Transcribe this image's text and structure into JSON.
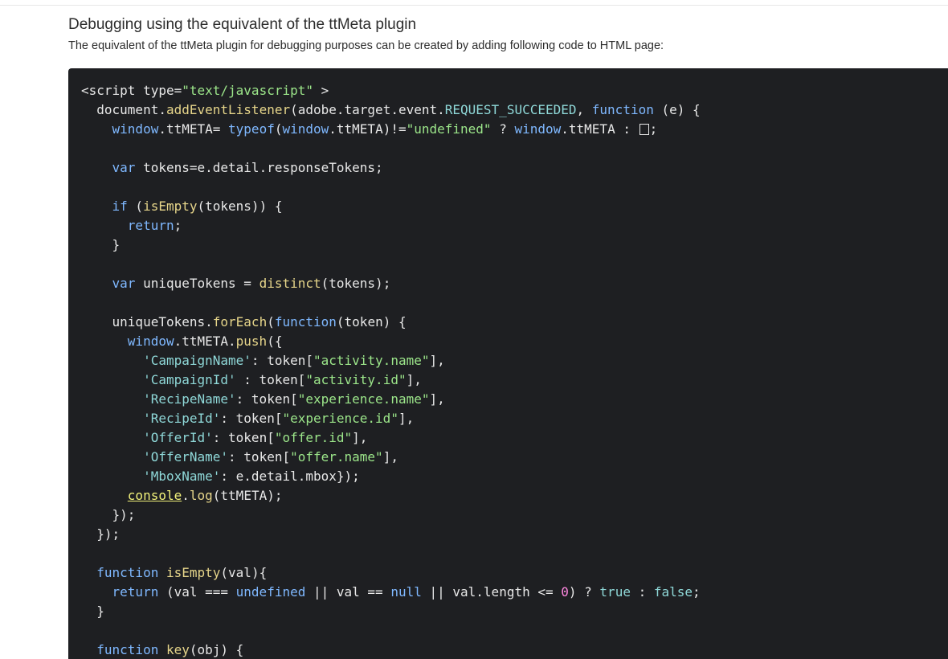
{
  "section": {
    "heading": "Debugging using the equivalent of the ttMeta plugin",
    "description": "The equivalent of the ttMeta plugin for debugging purposes can be created by adding following code to HTML page:"
  },
  "colors": {
    "code_background": "#1e1f22",
    "keyword": "#7fb8ff",
    "function": "#e6d58a",
    "string": "#9ce68a",
    "constant": "#8fd8d8",
    "number": "#ff88e0"
  },
  "code": {
    "language": "javascript",
    "lines": [
      [
        {
          "t": "<script type=",
          "c": "plain"
        },
        {
          "t": "\"text/javascript\"",
          "c": "str"
        },
        {
          "t": " >",
          "c": "plain"
        }
      ],
      [
        {
          "t": "  document.",
          "c": "plain"
        },
        {
          "t": "addEventListener",
          "c": "fn"
        },
        {
          "t": "(adobe.target.event.",
          "c": "plain"
        },
        {
          "t": "REQUEST_SUCCEEDED",
          "c": "const"
        },
        {
          "t": ", ",
          "c": "plain"
        },
        {
          "t": "function",
          "c": "kw"
        },
        {
          "t": " (e) {",
          "c": "plain"
        }
      ],
      [
        {
          "t": "    ",
          "c": "plain"
        },
        {
          "t": "window",
          "c": "kw"
        },
        {
          "t": ".ttMETA= ",
          "c": "plain"
        },
        {
          "t": "typeof",
          "c": "kw"
        },
        {
          "t": "(",
          "c": "plain"
        },
        {
          "t": "window",
          "c": "kw"
        },
        {
          "t": ".ttMETA)!=",
          "c": "plain"
        },
        {
          "t": "\"undefined\"",
          "c": "str"
        },
        {
          "t": " ? ",
          "c": "plain"
        },
        {
          "t": "window",
          "c": "kw"
        },
        {
          "t": ".ttMETA : ",
          "c": "plain"
        },
        {
          "t": "",
          "c": "box"
        },
        {
          "t": ";",
          "c": "plain"
        }
      ],
      [],
      [
        {
          "t": "    ",
          "c": "plain"
        },
        {
          "t": "var",
          "c": "kw"
        },
        {
          "t": " tokens=e.detail.responseTokens;",
          "c": "plain"
        }
      ],
      [],
      [
        {
          "t": "    ",
          "c": "plain"
        },
        {
          "t": "if",
          "c": "kw"
        },
        {
          "t": " (",
          "c": "plain"
        },
        {
          "t": "isEmpty",
          "c": "fn"
        },
        {
          "t": "(tokens)) {",
          "c": "plain"
        }
      ],
      [
        {
          "t": "      ",
          "c": "plain"
        },
        {
          "t": "return",
          "c": "kw"
        },
        {
          "t": ";",
          "c": "plain"
        }
      ],
      [
        {
          "t": "    }",
          "c": "plain"
        }
      ],
      [],
      [
        {
          "t": "    ",
          "c": "plain"
        },
        {
          "t": "var",
          "c": "kw"
        },
        {
          "t": " uniqueTokens = ",
          "c": "plain"
        },
        {
          "t": "distinct",
          "c": "fn"
        },
        {
          "t": "(tokens);",
          "c": "plain"
        }
      ],
      [],
      [
        {
          "t": "    uniqueTokens.",
          "c": "plain"
        },
        {
          "t": "forEach",
          "c": "fn"
        },
        {
          "t": "(",
          "c": "plain"
        },
        {
          "t": "function",
          "c": "kw"
        },
        {
          "t": "(token) {",
          "c": "plain"
        }
      ],
      [
        {
          "t": "      ",
          "c": "plain"
        },
        {
          "t": "window",
          "c": "kw"
        },
        {
          "t": ".ttMETA.",
          "c": "plain"
        },
        {
          "t": "push",
          "c": "fn"
        },
        {
          "t": "({",
          "c": "plain"
        }
      ],
      [
        {
          "t": "        ",
          "c": "plain"
        },
        {
          "t": "'CampaignName'",
          "c": "const"
        },
        {
          "t": ": token[",
          "c": "plain"
        },
        {
          "t": "\"activity.name\"",
          "c": "str"
        },
        {
          "t": "],",
          "c": "plain"
        }
      ],
      [
        {
          "t": "        ",
          "c": "plain"
        },
        {
          "t": "'CampaignId'",
          "c": "const"
        },
        {
          "t": " : token[",
          "c": "plain"
        },
        {
          "t": "\"activity.id\"",
          "c": "str"
        },
        {
          "t": "],",
          "c": "plain"
        }
      ],
      [
        {
          "t": "        ",
          "c": "plain"
        },
        {
          "t": "'RecipeName'",
          "c": "const"
        },
        {
          "t": ": token[",
          "c": "plain"
        },
        {
          "t": "\"experience.name\"",
          "c": "str"
        },
        {
          "t": "],",
          "c": "plain"
        }
      ],
      [
        {
          "t": "        ",
          "c": "plain"
        },
        {
          "t": "'RecipeId'",
          "c": "const"
        },
        {
          "t": ": token[",
          "c": "plain"
        },
        {
          "t": "\"experience.id\"",
          "c": "str"
        },
        {
          "t": "],",
          "c": "plain"
        }
      ],
      [
        {
          "t": "        ",
          "c": "plain"
        },
        {
          "t": "'OfferId'",
          "c": "const"
        },
        {
          "t": ": token[",
          "c": "plain"
        },
        {
          "t": "\"offer.id\"",
          "c": "str"
        },
        {
          "t": "],",
          "c": "plain"
        }
      ],
      [
        {
          "t": "        ",
          "c": "plain"
        },
        {
          "t": "'OfferName'",
          "c": "const"
        },
        {
          "t": ": token[",
          "c": "plain"
        },
        {
          "t": "\"offer.name\"",
          "c": "str"
        },
        {
          "t": "],",
          "c": "plain"
        }
      ],
      [
        {
          "t": "        ",
          "c": "plain"
        },
        {
          "t": "'MboxName'",
          "c": "const"
        },
        {
          "t": ": e.detail.mbox});",
          "c": "plain"
        }
      ],
      [
        {
          "t": "      ",
          "c": "plain"
        },
        {
          "t": "console",
          "c": "builtin"
        },
        {
          "t": ".",
          "c": "plain"
        },
        {
          "t": "log",
          "c": "fn"
        },
        {
          "t": "(ttMETA);",
          "c": "plain"
        }
      ],
      [
        {
          "t": "    });",
          "c": "plain"
        }
      ],
      [
        {
          "t": "  });",
          "c": "plain"
        }
      ],
      [],
      [
        {
          "t": "  ",
          "c": "plain"
        },
        {
          "t": "function",
          "c": "kw"
        },
        {
          "t": " ",
          "c": "plain"
        },
        {
          "t": "isEmpty",
          "c": "fn"
        },
        {
          "t": "(val){",
          "c": "plain"
        }
      ],
      [
        {
          "t": "    ",
          "c": "plain"
        },
        {
          "t": "return",
          "c": "kw"
        },
        {
          "t": " (val === ",
          "c": "plain"
        },
        {
          "t": "undefined",
          "c": "kw"
        },
        {
          "t": " || val == ",
          "c": "plain"
        },
        {
          "t": "null",
          "c": "kw"
        },
        {
          "t": " || val.length <= ",
          "c": "plain"
        },
        {
          "t": "0",
          "c": "num"
        },
        {
          "t": ") ? ",
          "c": "plain"
        },
        {
          "t": "true",
          "c": "const"
        },
        {
          "t": " : ",
          "c": "plain"
        },
        {
          "t": "false",
          "c": "const"
        },
        {
          "t": ";",
          "c": "plain"
        }
      ],
      [
        {
          "t": "  }",
          "c": "plain"
        }
      ],
      [],
      [
        {
          "t": "  ",
          "c": "plain"
        },
        {
          "t": "function",
          "c": "kw"
        },
        {
          "t": " ",
          "c": "plain"
        },
        {
          "t": "key",
          "c": "fn"
        },
        {
          "t": "(obj) {",
          "c": "plain"
        }
      ]
    ]
  }
}
